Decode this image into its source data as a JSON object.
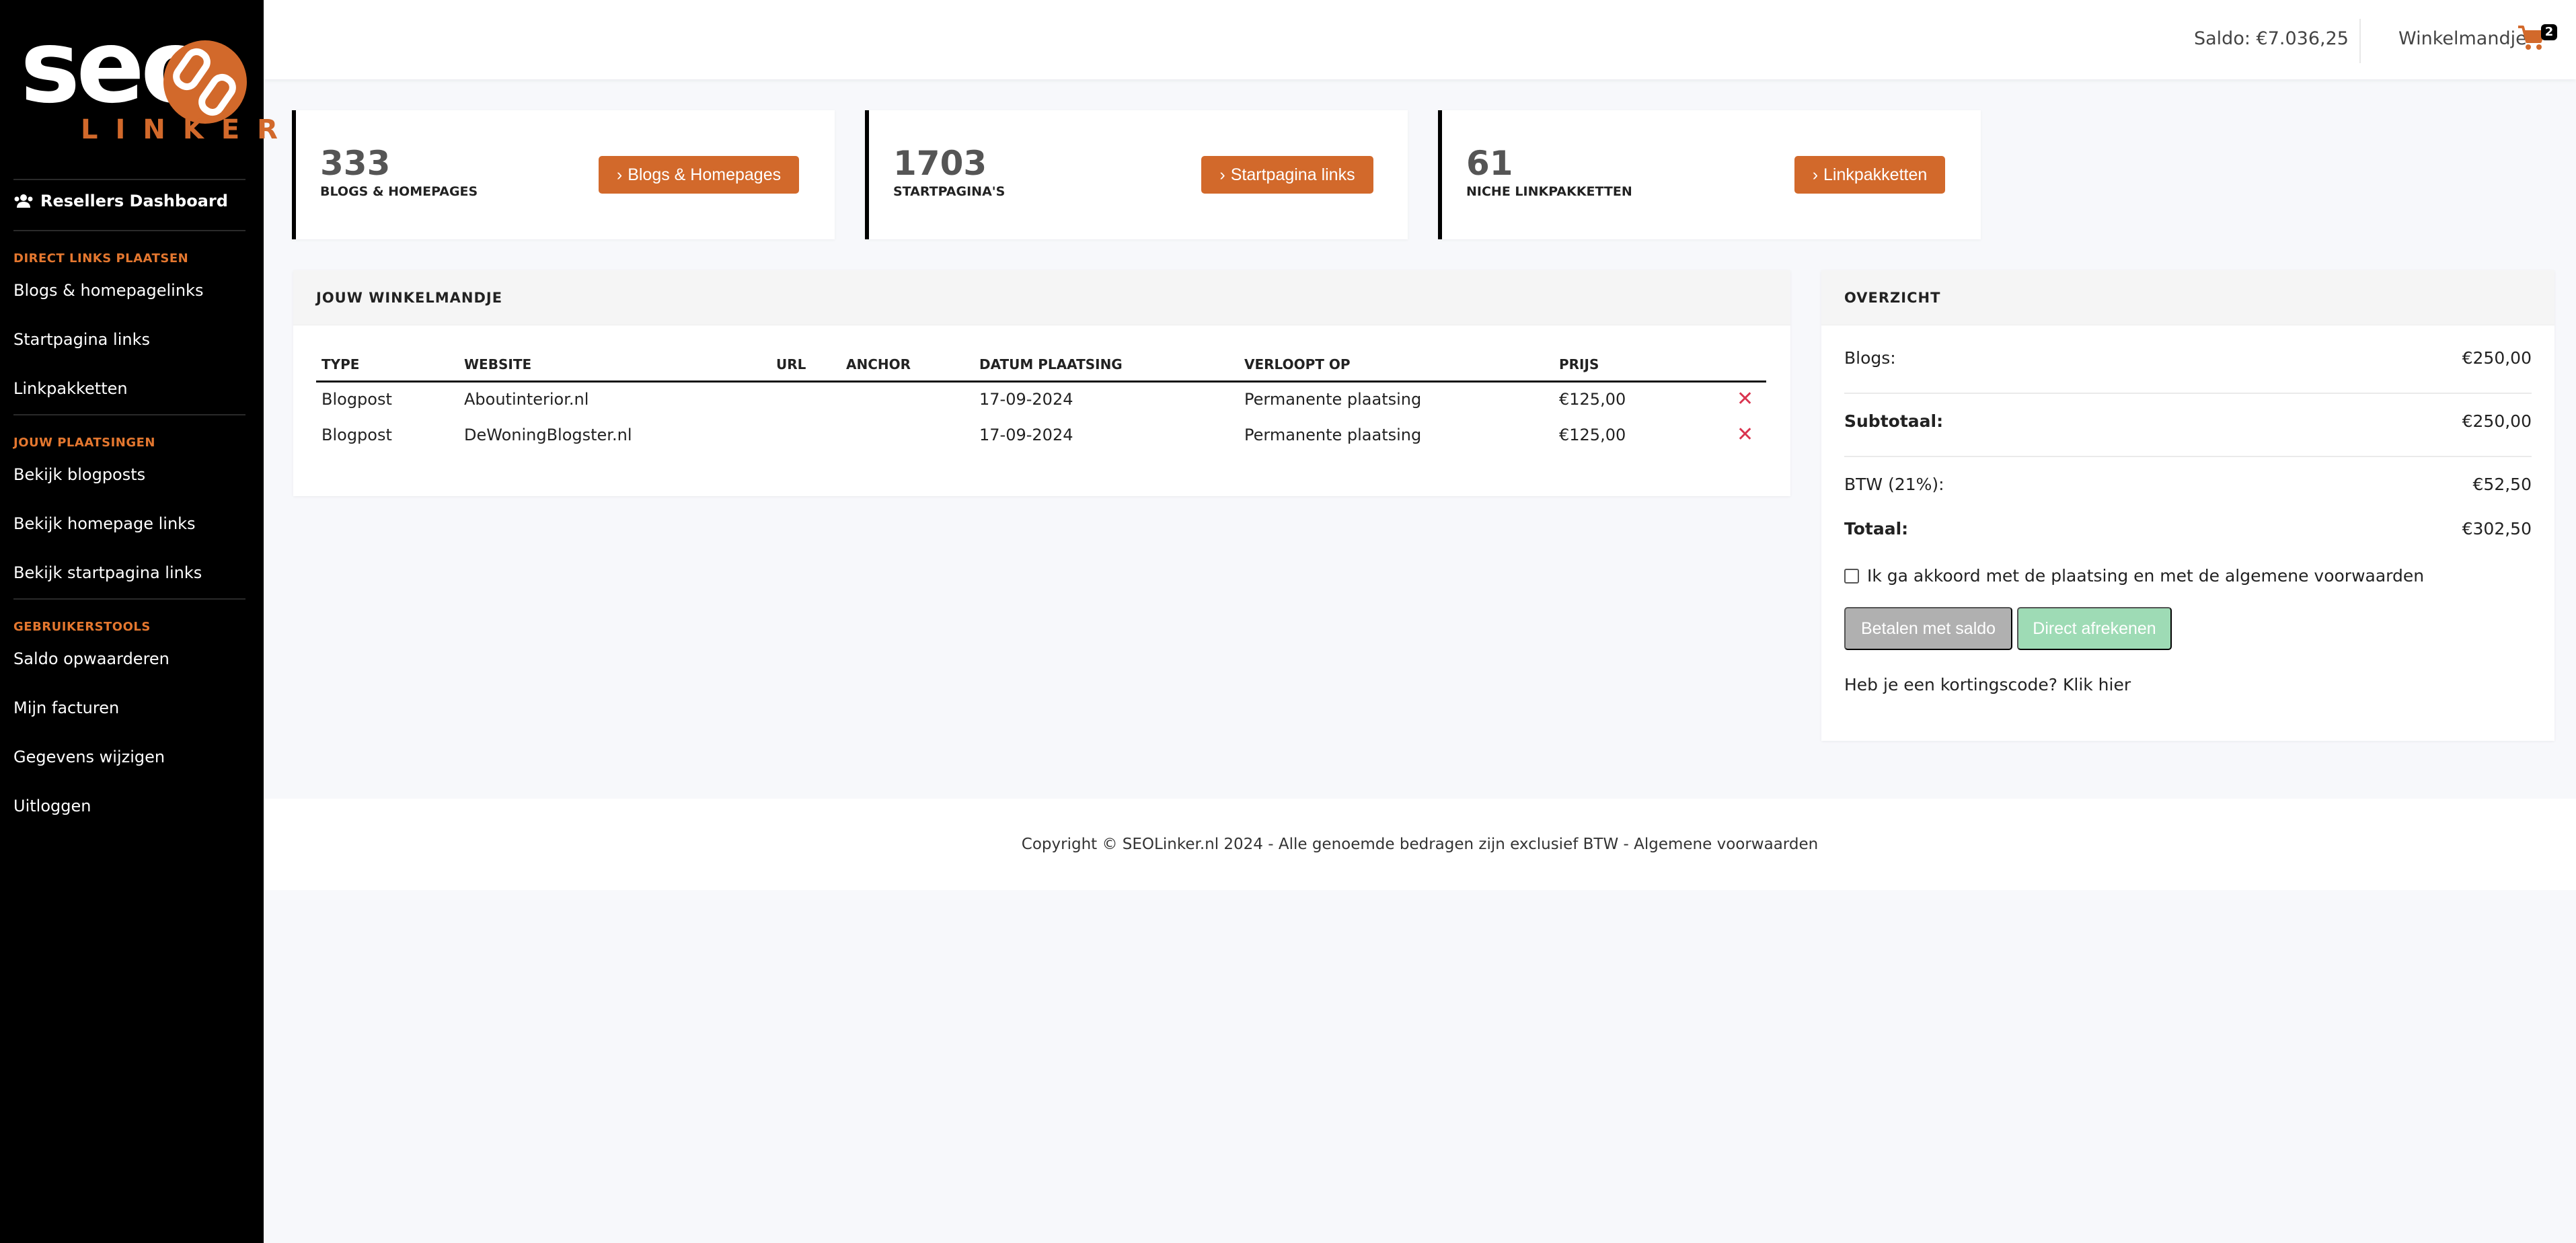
{
  "brand": {
    "logo_top": "seo",
    "logo_bottom": "LINKER",
    "accent": "#d2692b"
  },
  "sidebar": {
    "dashboard_label": "Resellers Dashboard",
    "sections": [
      {
        "title": "DIRECT LINKS PLAATSEN",
        "items": [
          "Blogs & homepagelinks",
          "Startpagina links",
          "Linkpakketten"
        ]
      },
      {
        "title": "JOUW PLAATSINGEN",
        "items": [
          "Bekijk blogposts",
          "Bekijk homepage links",
          "Bekijk startpagina links"
        ]
      },
      {
        "title": "GEBRUIKERSTOOLS",
        "items": [
          "Saldo opwaarderen",
          "Mijn facturen",
          "Gegevens wijzigen",
          "Uitloggen"
        ]
      }
    ]
  },
  "header": {
    "saldo": "Saldo: €7.036,25",
    "cart_label": "Winkelmandje",
    "cart_count": "2"
  },
  "stats": [
    {
      "value": "333",
      "label": "BLOGS & HOMEPAGES",
      "button": "Blogs & Homepages"
    },
    {
      "value": "1703",
      "label": "STARTPAGINA'S",
      "button": "Startpagina links"
    },
    {
      "value": "61",
      "label": "NICHE LINKPAKKETTEN",
      "button": "Linkpakketten"
    }
  ],
  "cart": {
    "title": "JOUW WINKELMANDJE",
    "columns": [
      "TYPE",
      "WEBSITE",
      "URL",
      "ANCHOR",
      "DATUM PLAATSING",
      "VERLOOPT OP",
      "PRIJS"
    ],
    "rows": [
      {
        "type": "Blogpost",
        "website": "Aboutinterior.nl",
        "url": "",
        "anchor": "",
        "date": "17-09-2024",
        "expires": "Permanente plaatsing",
        "price": "€125,00"
      },
      {
        "type": "Blogpost",
        "website": "DeWoningBlogster.nl",
        "url": "",
        "anchor": "",
        "date": "17-09-2024",
        "expires": "Permanente plaatsing",
        "price": "€125,00"
      }
    ],
    "delete_symbol": "✕"
  },
  "overview": {
    "title": "OVERZICHT",
    "blogs_label": "Blogs:",
    "blogs_value": "€250,00",
    "subtotal_label": "Subtotaal:",
    "subtotal_value": "€250,00",
    "vat_label": "BTW (21%):",
    "vat_value": "€52,50",
    "total_label": "Totaal:",
    "total_value": "€302,50",
    "agree_text": "Ik ga akkoord met de plaatsing en met de algemene voorwaarden",
    "pay_balance": "Betalen met saldo",
    "pay_direct": "Direct afrekenen",
    "coupon_text": "Heb je een kortingscode? Klik hier"
  },
  "footer": {
    "text": "Copyright © SEOLinker.nl 2024 - Alle genoemde bedragen zijn exclusief BTW - Algemene voorwaarden"
  }
}
